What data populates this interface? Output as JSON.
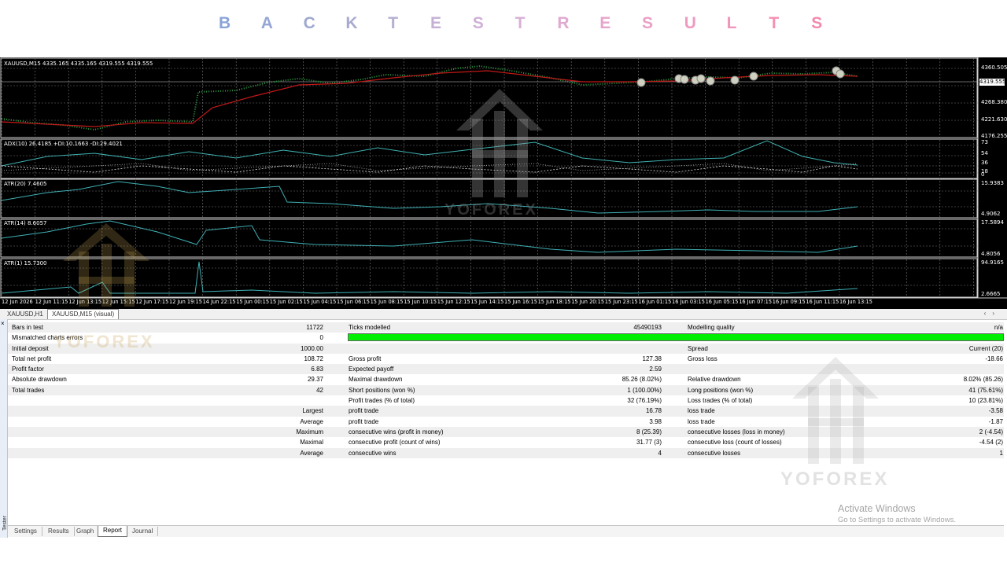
{
  "title_letters": [
    "B",
    "A",
    "C",
    "K",
    "T",
    "E",
    "S",
    "T",
    "R",
    "E",
    "S",
    "U",
    "L",
    "T",
    "S"
  ],
  "title_colors": [
    "#8aa4d8",
    "#94a6d4",
    "#9ea8d0",
    "#a9aad0",
    "#b7aed2",
    "#c4b0d4",
    "#cfb0d6",
    "#d8b0d6",
    "#e0a9cf",
    "#e6a5cc",
    "#eb9fc6",
    "#ef9ac1",
    "#f295bb",
    "#f58fb4",
    "#f489ac"
  ],
  "chart": {
    "main_label": "XAUUSD,M15  4335.165 4335.165 4319.555 4319.555",
    "main_scale": [
      "4360.505",
      "4268.380",
      "4221.630",
      "4176.255"
    ],
    "current_price": "4319.555",
    "adx_label": "ADX(10) 26.4185 +DI:10.1663 -DI:29.4021",
    "adx_scale": [
      "73",
      "54",
      "36",
      "18",
      "0"
    ],
    "atr20_label": "ATR(20) 7.4605",
    "atr20_scale": [
      "15.9383",
      "4.9062"
    ],
    "atr14_label": "ATR(14) 8.6057",
    "atr14_scale": [
      "17.5894",
      "4.8056"
    ],
    "atr1_label": "ATR(1) 15.7300",
    "atr1_scale": [
      "94.9165",
      "2.6665"
    ],
    "time_labels": [
      "12 Jun 2026",
      "12 Jun 11:15",
      "12 Jun 13:15",
      "12 Jun 15:15",
      "12 Jun 17:15",
      "12 Jun 19:15",
      "14 Jun 22:15",
      "15 Jun 00:15",
      "15 Jun 02:15",
      "15 Jun 04:15",
      "15 Jun 06:15",
      "15 Jun 08:15",
      "15 Jun 10:15",
      "15 Jun 12:15",
      "15 Jun 14:15",
      "15 Jun 16:15",
      "15 Jun 18:15",
      "15 Jun 20:15",
      "15 Jun 23:15",
      "16 Jun 01:15",
      "16 Jun 03:15",
      "16 Jun 05:15",
      "16 Jun 07:15",
      "16 Jun 09:15",
      "16 Jun 11:15",
      "16 Jun 13:15"
    ]
  },
  "chart_tabs": [
    "XAUUSD,H1",
    "XAUUSD,M15 (visual)"
  ],
  "report": {
    "bars_in_test": {
      "label": "Bars in test",
      "value": "11722"
    },
    "ticks_modelled": {
      "label": "Ticks modelled",
      "value": "45490193"
    },
    "modelling_quality": {
      "label": "Modelling quality",
      "value": "n/a"
    },
    "mismatched": {
      "label": "Mismatched charts errors",
      "value": "0"
    },
    "initial_deposit": {
      "label": "Initial deposit",
      "value": "1000.00"
    },
    "spread": {
      "label": "Spread",
      "value": "Current (20)"
    },
    "total_net_profit": {
      "label": "Total net profit",
      "value": "108.72"
    },
    "gross_profit": {
      "label": "Gross profit",
      "value": "127.38"
    },
    "gross_loss": {
      "label": "Gross loss",
      "value": "-18.66"
    },
    "profit_factor": {
      "label": "Profit factor",
      "value": "6.83"
    },
    "expected_payoff": {
      "label": "Expected payoff",
      "value": "2.59"
    },
    "absolute_drawdown": {
      "label": "Absolute drawdown",
      "value": "29.37"
    },
    "maximal_drawdown": {
      "label": "Maximal drawdown",
      "value": "85.26 (8.02%)"
    },
    "relative_drawdown": {
      "label": "Relative drawdown",
      "value": "8.02% (85.26)"
    },
    "total_trades": {
      "label": "Total trades",
      "value": "42"
    },
    "short_positions": {
      "label": "Short positions (won %)",
      "value": "1 (100.00%)"
    },
    "long_positions": {
      "label": "Long positions (won %)",
      "value": "41 (75.61%)"
    },
    "profit_trades": {
      "label": "Profit trades (% of total)",
      "value": "32 (76.19%)"
    },
    "loss_trades": {
      "label": "Loss trades (% of total)",
      "value": "10 (23.81%)"
    },
    "largest": {
      "label": "Largest",
      "p_label": "profit trade",
      "p_value": "16.78",
      "l_label": "loss trade",
      "l_value": "-3.58"
    },
    "average": {
      "label": "Average",
      "p_label": "profit trade",
      "p_value": "3.98",
      "l_label": "loss trade",
      "l_value": "-1.87"
    },
    "maximum": {
      "label": "Maximum",
      "p_label": "consecutive wins (profit in money)",
      "p_value": "8 (25.39)",
      "l_label": "consecutive losses (loss in money)",
      "l_value": "2 (-4.54)"
    },
    "maximal": {
      "label": "Maximal",
      "p_label": "consecutive profit (count of wins)",
      "p_value": "31.77 (3)",
      "l_label": "consecutive loss (count of losses)",
      "l_value": "-4.54 (2)"
    },
    "average2": {
      "label": "Average",
      "p_label": "consecutive wins",
      "p_value": "4",
      "l_label": "consecutive losses",
      "l_value": "1"
    }
  },
  "bottom_tabs": [
    "Settings",
    "Results",
    "Graph",
    "Report",
    "Journal"
  ],
  "side_label": "Tester",
  "watermark": "YOFOREX",
  "activate": {
    "line1": "Activate Windows",
    "line2": "Go to Settings to activate Windows."
  }
}
